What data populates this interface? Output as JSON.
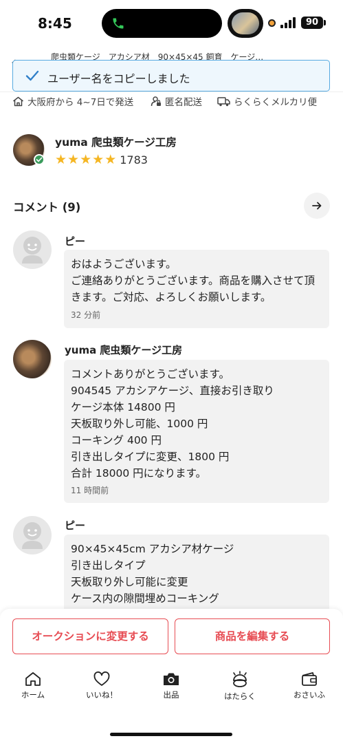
{
  "status_bar": {
    "time": "8:45",
    "battery": "90"
  },
  "header": {
    "title": "爬虫類ケージ　アカシア材　90×45×45 飼育　ケージ…"
  },
  "toast": {
    "message": "ユーザー名をコピーしました"
  },
  "shipping": {
    "origin": "大阪府から 4~7日で発送",
    "anonymous": "匿名配送",
    "method": "らくらくメルカリ便"
  },
  "seller": {
    "name": "yuma 爬虫類ケージ工房",
    "rating_count": "1783",
    "stars": 5
  },
  "comments_section": {
    "title": "コメント (9)"
  },
  "comments": [
    {
      "author": "ピー",
      "body": "おはようございます。\nご連絡ありがとうございます。商品を購入させて頂きます。ご対応、よろしくお願いします。",
      "time": "32 分前"
    },
    {
      "author": "yuma 爬虫類ケージ工房",
      "body": "コメントありがとうございます。\n904545 アカシアケージ、直接お引き取り\nケージ本体 14800 円\n天板取り外し可能、1000 円\nコーキング 400 円\n引き出しタイプに変更、1800 円\n合計 18000 円になります。",
      "time": "11 時間前"
    },
    {
      "author": "ピー",
      "body": "90×45×45cm アカシア材ケージ\n引き出しタイプ\n天板取り外し可能に変更\nケース内の隙間埋めコーキング",
      "time": ""
    }
  ],
  "actions": {
    "auction": "オークションに変更する",
    "edit": "商品を編集する"
  },
  "tabs": [
    {
      "label": "ホーム",
      "icon": "home-icon"
    },
    {
      "label": "いいね！",
      "icon": "heart-icon"
    },
    {
      "label": "出品",
      "icon": "camera-icon"
    },
    {
      "label": "はたらく",
      "icon": "work-icon"
    },
    {
      "label": "おさいふ",
      "icon": "wallet-icon"
    }
  ],
  "colors": {
    "accent": "#e74c53",
    "toast_border": "#55a9e0",
    "star": "#f5b623"
  }
}
